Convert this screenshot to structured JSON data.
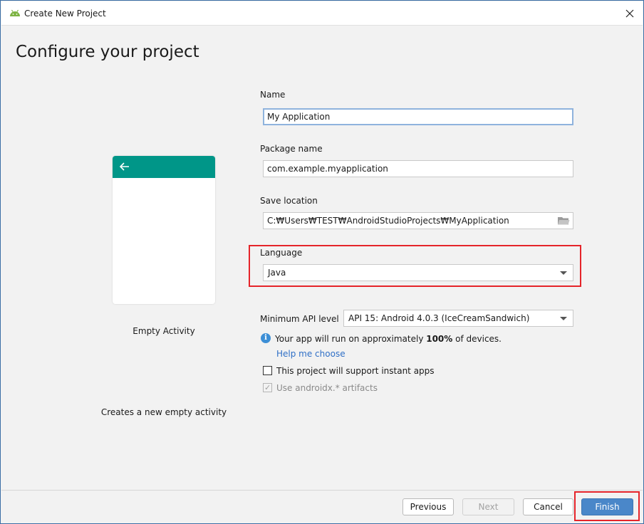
{
  "window": {
    "title": "Create New Project",
    "close_icon": "close-icon",
    "app_icon": "android-icon"
  },
  "page": {
    "title": "Configure your project"
  },
  "template": {
    "name": "Empty Activity",
    "description": "Creates a new empty activity",
    "appbar_color": "#009688",
    "back_icon": "arrow-left-icon"
  },
  "form": {
    "name": {
      "label": "Name",
      "value": "My Application"
    },
    "package": {
      "label": "Package name",
      "value": "com.example.myapplication"
    },
    "save_location": {
      "label": "Save location",
      "value": "C:\\Users\\TEST\\AndroidStudioProjects\\MyApplication",
      "display_value": "C:₩Users₩TEST₩AndroidStudioProjects₩MyApplication",
      "browse_icon": "folder-icon"
    },
    "language": {
      "label": "Language",
      "value": "Java"
    },
    "min_api": {
      "label": "Minimum API level",
      "value": "API 15: Android 4.0.3 (IceCreamSandwich)"
    },
    "info": {
      "prefix": "Your app will run on approximately ",
      "percent": "100%",
      "suffix": " of devices.",
      "icon": "info-icon"
    },
    "help_link": "Help me choose",
    "instant_apps": {
      "label": "This project will support instant apps",
      "checked": false
    },
    "androidx": {
      "label": "Use androidx.* artifacts",
      "checked": true,
      "disabled": true
    }
  },
  "footer": {
    "previous": "Previous",
    "next": "Next",
    "cancel": "Cancel",
    "finish": "Finish"
  },
  "colors": {
    "accent": "#4a87c9",
    "highlight": "#e5242a",
    "link": "#2f6fc6",
    "info": "#3d8fd6"
  }
}
